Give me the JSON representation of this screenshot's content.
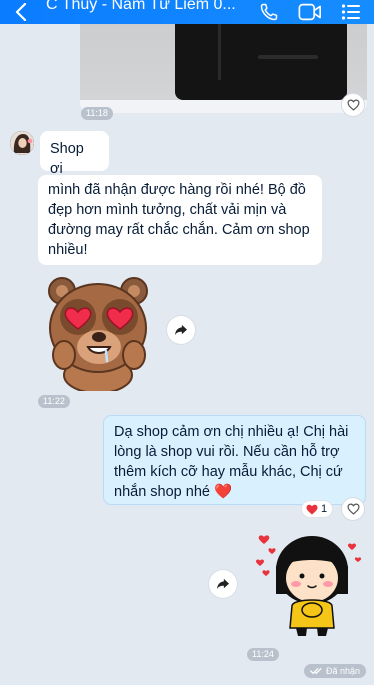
{
  "header": {
    "title": "C Thủy  - Nam Từ Liêm 0...",
    "icons": [
      "back-arrow-icon",
      "phone-icon",
      "video-call-icon",
      "menu-icon"
    ],
    "background": "#0a84ff"
  },
  "messages": [
    {
      "type": "image",
      "time": "11:18"
    },
    {
      "type": "text",
      "from": "customer",
      "text": "Shop ơi"
    },
    {
      "type": "text",
      "from": "customer",
      "text": "mình đã nhận được hàng rồi nhé! Bộ đồ đẹp hơn mình tưởng, chất vải mịn và đường may rất chắc chắn. Cảm ơn shop nhiều!"
    },
    {
      "type": "sticker",
      "from": "customer",
      "sticker": "bear-heart-eyes",
      "time": "11:22"
    },
    {
      "type": "text",
      "from": "shop",
      "text": "Dạ shop cảm ơn chị nhiều ạ! Chị hài lòng là shop vui rồi. Nếu cần hỗ trợ thêm kích cỡ hay mẫu khác, Chị cứ nhắn shop nhé ❤️",
      "reaction_count": "1"
    },
    {
      "type": "sticker",
      "from": "shop",
      "sticker": "girl-with-hearts",
      "time": "11:24"
    }
  ],
  "status": {
    "received_label": "Đã nhận"
  },
  "colors": {
    "accent": "#0a84ff",
    "my_bubble": "#d9f0ff",
    "chat_bg": "#e2e9f1",
    "heart": "#e8323c"
  }
}
